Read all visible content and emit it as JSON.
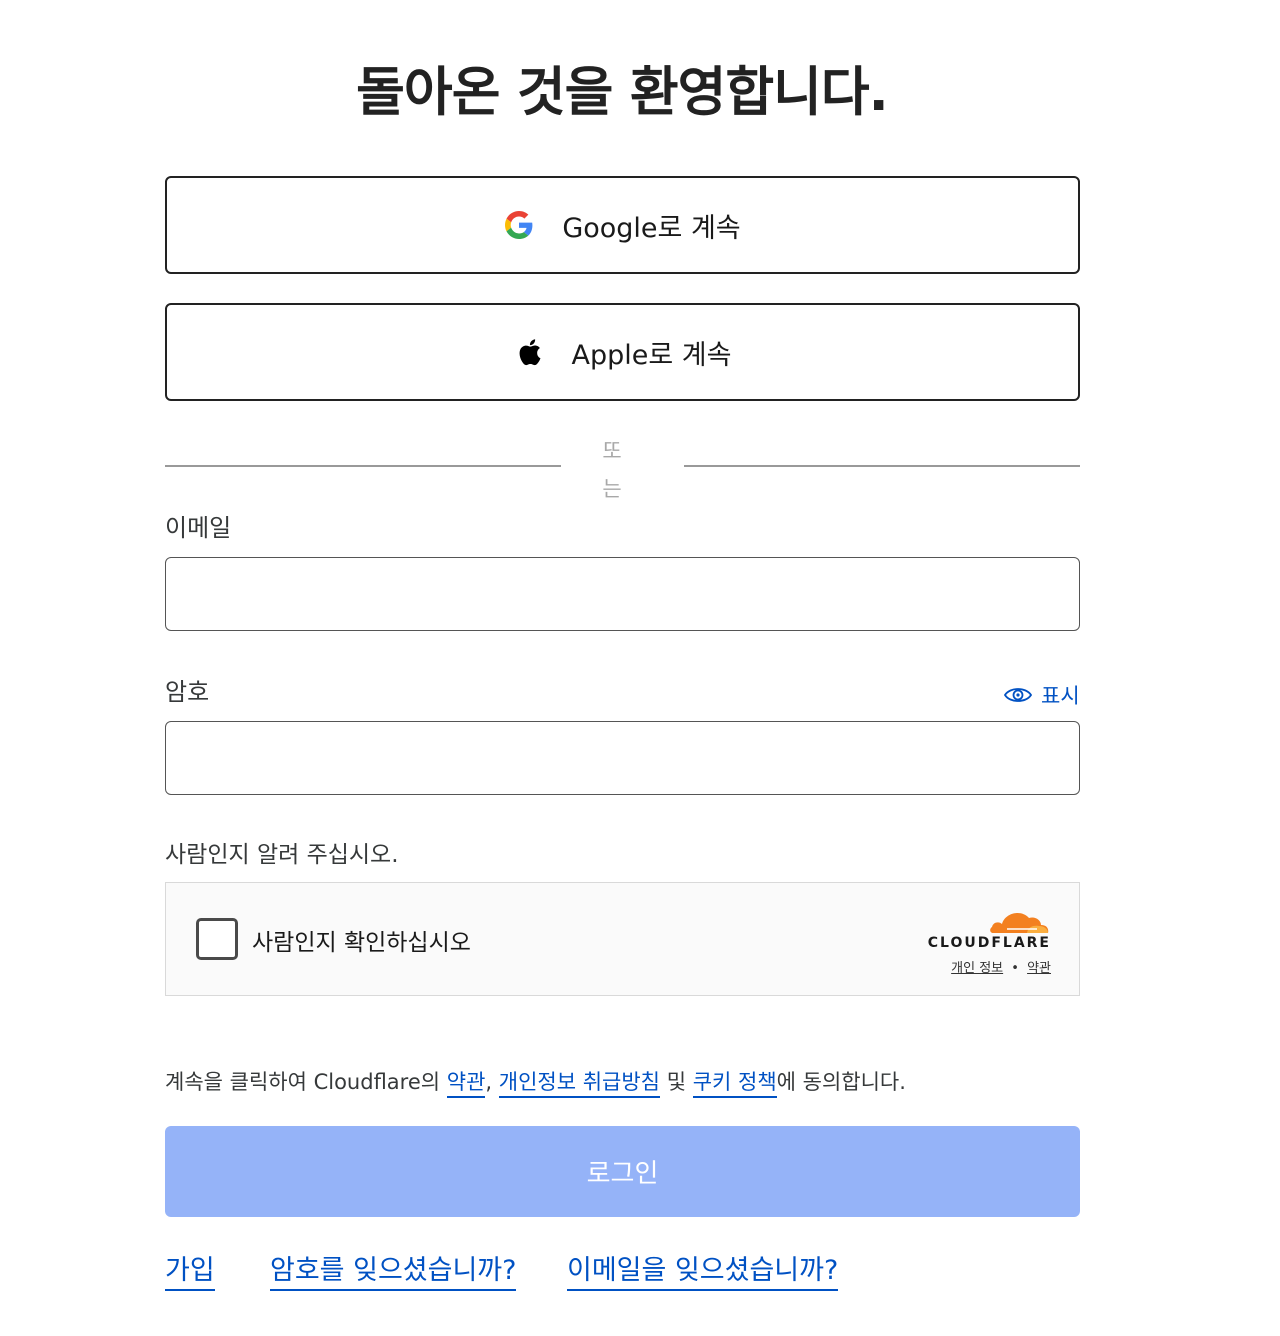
{
  "title": "돌아온 것을 환영합니다.",
  "sso": {
    "google_label": "Google로 계속",
    "apple_label": "Apple로 계속"
  },
  "divider_text": "또는",
  "email": {
    "label": "이메일",
    "value": "",
    "placeholder": ""
  },
  "password": {
    "label": "암호",
    "value": "",
    "placeholder": "",
    "show_label": "표시"
  },
  "captcha": {
    "prompt": "사람인지 알려 주십시오.",
    "checkbox_label": "사람인지 확인하십시오",
    "brand": "CLOUDFLARE",
    "privacy_link": "개인 정보",
    "separator": "•",
    "terms_link": "약관"
  },
  "consent": {
    "prefix": "계속을 클릭하여 Cloudflare의 ",
    "terms": "약관",
    "comma": ", ",
    "privacy": "개인정보 취급방침",
    "and": " 및 ",
    "cookie": "쿠키 정책",
    "suffix": "에 동의합니다."
  },
  "login_button": "로그인",
  "links": {
    "signup": "가입",
    "forgot_password": "암호를 잊으셨습니까?",
    "forgot_email": "이메일을 잊으셨습니까?"
  },
  "colors": {
    "link": "#0051c3",
    "login_button_disabled": "#95b3f8",
    "cloudflare_orange": "#f38020"
  }
}
